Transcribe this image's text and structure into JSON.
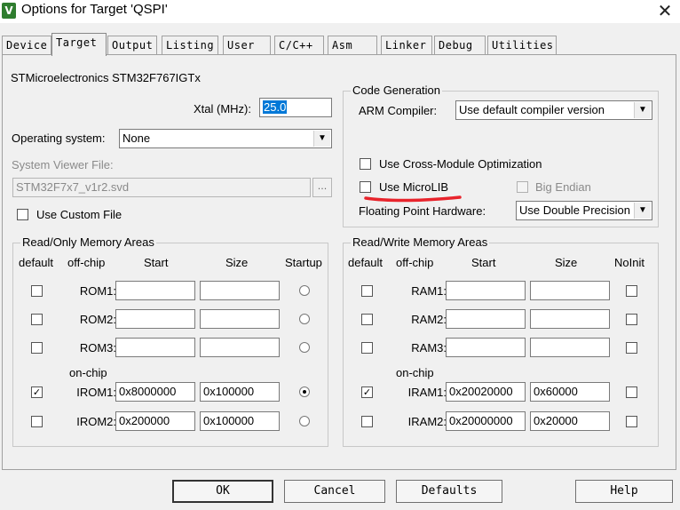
{
  "window": {
    "title": "Options for Target 'QSPI'",
    "app_icon_glyph": "V",
    "close_glyph": "✕"
  },
  "tabs": [
    "Device",
    "Target",
    "Output",
    "Listing",
    "User",
    "C/C++",
    "Asm",
    "Linker",
    "Debug",
    "Utilities"
  ],
  "active_tab": "Target",
  "device": {
    "name": "STMicroelectronics STM32F767IGTx",
    "xtal_label": "Xtal (MHz):",
    "xtal_value": "25.0"
  },
  "os": {
    "label": "Operating system:",
    "value": "None"
  },
  "svd": {
    "label": "System Viewer File:",
    "value": "STM32F7x7_v1r2.svd",
    "browse": "...",
    "custom_label": "Use Custom File"
  },
  "codegen": {
    "title": "Code Generation",
    "compiler_label": "ARM Compiler:",
    "compiler_value": "Use default compiler version",
    "cross_module": "Use Cross-Module Optimization",
    "microlib": "Use MicroLIB",
    "big_endian": "Big Endian",
    "fpu_label": "Floating Point Hardware:",
    "fpu_value": "Use Double Precision"
  },
  "rom": {
    "title": "Read/Only Memory Areas",
    "headers": {
      "default": "default",
      "offchip": "off-chip",
      "start": "Start",
      "size": "Size",
      "startup": "Startup"
    },
    "onchip_label": "on-chip",
    "rows": [
      {
        "label": "ROM1:",
        "start": "",
        "size": "",
        "default": false,
        "startup": false
      },
      {
        "label": "ROM2:",
        "start": "",
        "size": "",
        "default": false,
        "startup": false
      },
      {
        "label": "ROM3:",
        "start": "",
        "size": "",
        "default": false,
        "startup": false
      },
      {
        "label": "IROM1:",
        "start": "0x8000000",
        "size": "0x100000",
        "default": true,
        "startup": true
      },
      {
        "label": "IROM2:",
        "start": "0x200000",
        "size": "0x100000",
        "default": false,
        "startup": false
      }
    ]
  },
  "ram": {
    "title": "Read/Write Memory Areas",
    "headers": {
      "default": "default",
      "offchip": "off-chip",
      "start": "Start",
      "size": "Size",
      "noinit": "NoInit"
    },
    "onchip_label": "on-chip",
    "rows": [
      {
        "label": "RAM1:",
        "start": "",
        "size": "",
        "default": false,
        "noinit": false
      },
      {
        "label": "RAM2:",
        "start": "",
        "size": "",
        "default": false,
        "noinit": false
      },
      {
        "label": "RAM3:",
        "start": "",
        "size": "",
        "default": false,
        "noinit": false
      },
      {
        "label": "IRAM1:",
        "start": "0x20020000",
        "size": "0x60000",
        "default": true,
        "noinit": false
      },
      {
        "label": "IRAM2:",
        "start": "0x20000000",
        "size": "0x20000",
        "default": false,
        "noinit": false
      }
    ]
  },
  "buttons": {
    "ok": "OK",
    "cancel": "Cancel",
    "defaults": "Defaults",
    "help": "Help"
  },
  "colors": {
    "annotation": "#e8242c",
    "selection": "#0078d7",
    "app_icon": "#2f7d2f"
  }
}
